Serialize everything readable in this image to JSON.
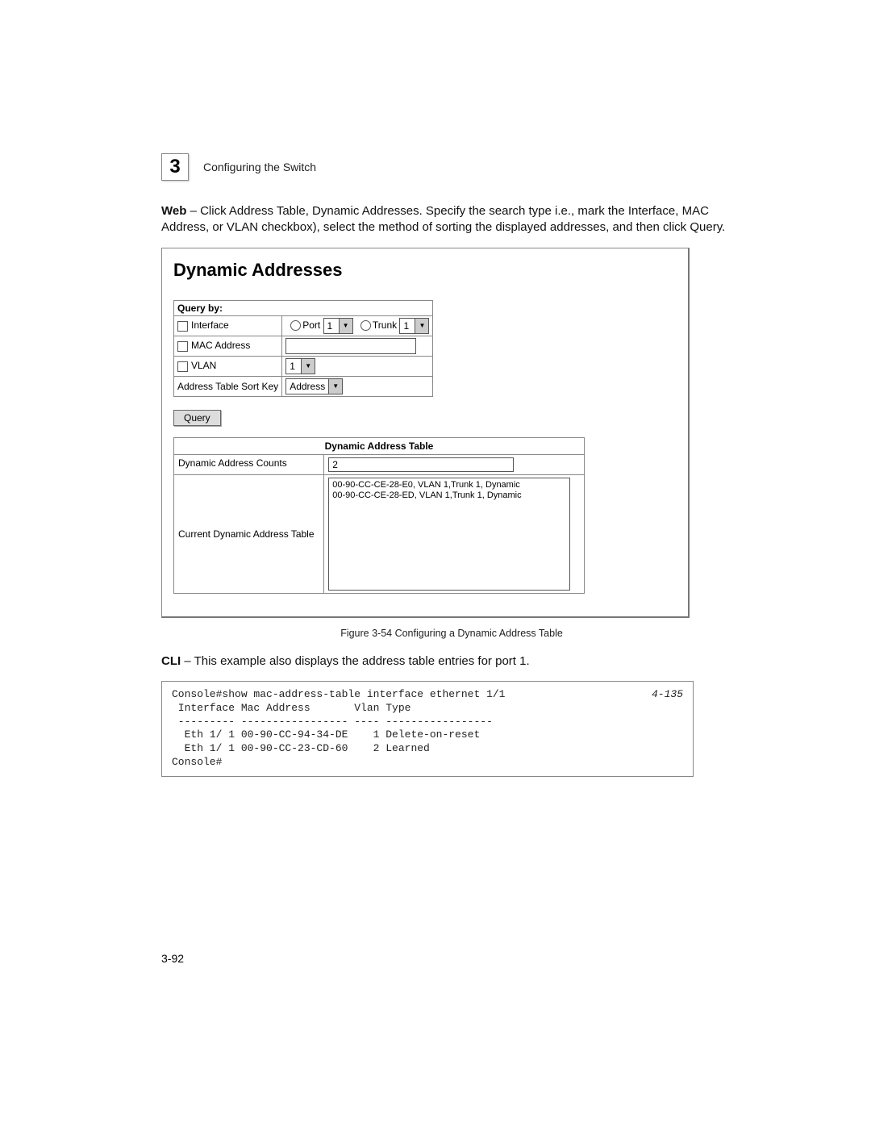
{
  "header": {
    "chapter_number": "3",
    "title": "Configuring the Switch"
  },
  "intro": {
    "prefix_bold": "Web",
    "text": " – Click Address Table, Dynamic Addresses. Specify the search type i.e., mark the Interface, MAC Address, or VLAN checkbox), select the method of sorting the displayed addresses, and then click Query."
  },
  "screenshot": {
    "title": "Dynamic Addresses",
    "query": {
      "header": "Query by:",
      "rows": {
        "interface": {
          "label": "Interface",
          "port_label": "Port",
          "port_value": "1",
          "trunk_label": "Trunk",
          "trunk_value": "1"
        },
        "mac": {
          "label": "MAC Address"
        },
        "vlan": {
          "label": "VLAN",
          "value": "1"
        },
        "sortkey": {
          "label": "Address Table Sort Key",
          "value": "Address"
        }
      },
      "button": "Query"
    },
    "table": {
      "header": "Dynamic Address Table",
      "counts_label": "Dynamic Address Counts",
      "counts_value": "2",
      "current_label": "Current Dynamic Address Table",
      "entries": [
        "00-90-CC-CE-28-E0, VLAN 1,Trunk 1, Dynamic",
        "00-90-CC-CE-28-ED, VLAN 1,Trunk 1, Dynamic"
      ]
    }
  },
  "figure_caption": "Figure 3-54  Configuring a Dynamic Address Table",
  "cli": {
    "prefix_bold": "CLI",
    "text": " – This example also displays the address table entries for port 1.",
    "ref": "4-135",
    "lines": [
      "Console#show mac-address-table interface ethernet 1/1",
      " Interface Mac Address       Vlan Type",
      " --------- ----------------- ---- -----------------",
      "  Eth 1/ 1 00-90-CC-94-34-DE    1 Delete-on-reset",
      "  Eth 1/ 1 00-90-CC-23-CD-60    2 Learned",
      "Console#"
    ]
  },
  "page_number": "3-92"
}
